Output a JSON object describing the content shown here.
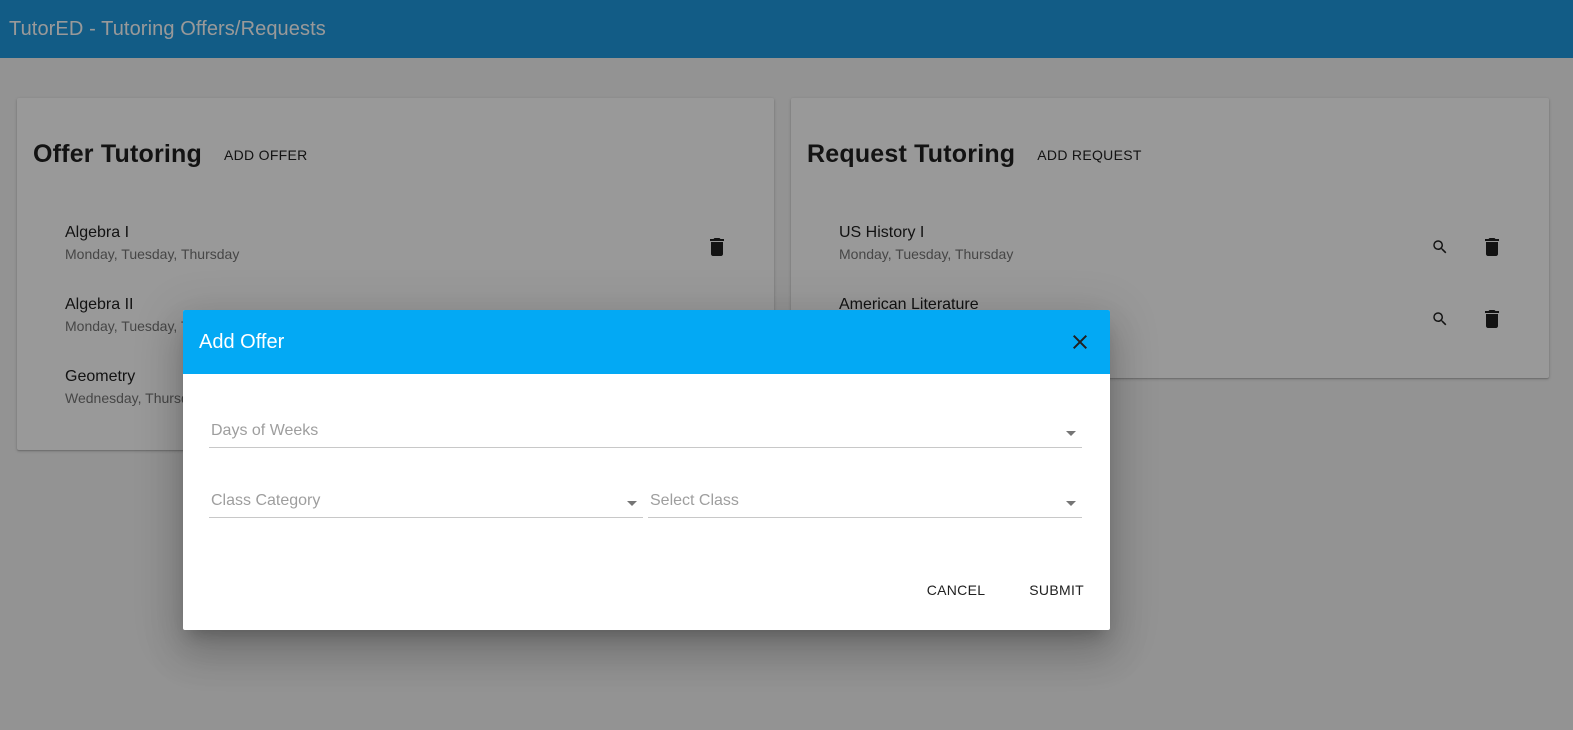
{
  "app": {
    "title": "TutorED - Tutoring Offers/Requests"
  },
  "offer_card": {
    "title": "Offer Tutoring",
    "add_label": "ADD OFFER",
    "items": [
      {
        "name": "Algebra I",
        "days": "Monday, Tuesday, Thursday"
      },
      {
        "name": "Algebra II",
        "days": "Monday, Tuesday, Thursday"
      },
      {
        "name": "Geometry",
        "days": "Wednesday, Thursday"
      }
    ]
  },
  "request_card": {
    "title": "Request Tutoring",
    "add_label": "ADD REQUEST",
    "items": [
      {
        "name": "US History I",
        "days": "Monday, Tuesday, Thursday"
      },
      {
        "name": "American Literature",
        "days": ""
      }
    ]
  },
  "dialog": {
    "title": "Add Offer",
    "days_placeholder": "Days of Weeks",
    "category_placeholder": "Class Category",
    "class_placeholder": "Select Class",
    "cancel_label": "CANCEL",
    "submit_label": "SUBMIT"
  },
  "colors": {
    "appbar": "#1e9ae0",
    "dialog_header": "#03a9f4",
    "backdrop": "rgba(0,0,0,0.4)"
  },
  "icons": {
    "delete": "delete-icon",
    "search": "search-icon",
    "close": "close-icon",
    "dropdown": "arrow-drop-down-icon"
  }
}
